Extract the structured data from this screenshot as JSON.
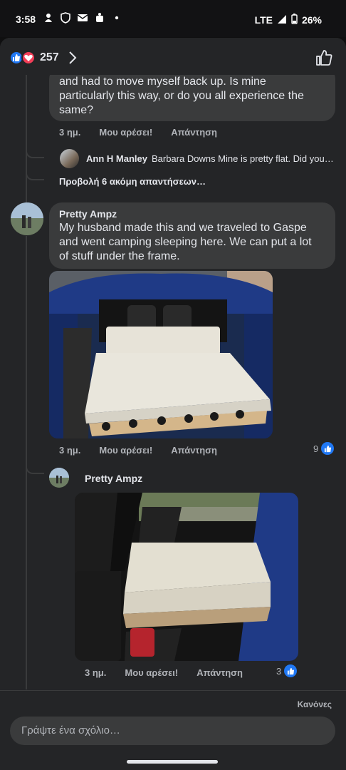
{
  "status": {
    "time": "3:58",
    "network": "LTE",
    "battery": "26%",
    "icons": [
      "notification-icon",
      "shield-icon",
      "mail-icon",
      "bot-icon",
      "dot-icon",
      "signal-icon",
      "battery-icon"
    ]
  },
  "reactions": {
    "count": "257",
    "icons": [
      "like-reaction-icon",
      "love-reaction-icon",
      "chevron-right-icon",
      "thumbs-up-outline-icon"
    ]
  },
  "comment1": {
    "text_lines": [
      "and had to move myself back up. Is mine",
      "particularly this way, or do you all experience the",
      "same?"
    ],
    "time": "3 ημ.",
    "like": "Μου αρέσει!",
    "reply": "Απάντηση"
  },
  "reply_preview": {
    "author": "Ann H Manley",
    "text": "Barbara Downs Mine is pretty flat. Did you…"
  },
  "more_replies": "Προβολή 6 ακόμη απαντήσεων…",
  "comment2": {
    "author": "Pretty Ampz",
    "text_lines": [
      "My husband made this and we traveled to  Gaspe",
      "and went camping sleeping here. We can put a lot",
      "of stuff under the frame."
    ],
    "time": "3 ημ.",
    "like": "Μου αρέσει!",
    "reply": "Απάντηση",
    "likes": "9"
  },
  "reply2": {
    "author": "Pretty Ampz",
    "time": "3 ημ.",
    "like": "Μου αρέσει!",
    "reply": "Απάντηση",
    "likes": "3"
  },
  "footer": {
    "rules": "Κανόνες",
    "input_placeholder": "Γράψτε ένα σχόλιο…"
  },
  "colors": {
    "background": "#242527",
    "bubble": "#3a3b3c",
    "like_blue": "#2078f4",
    "love_red": "#f33e58",
    "secondary_text": "#b0b3b8"
  }
}
